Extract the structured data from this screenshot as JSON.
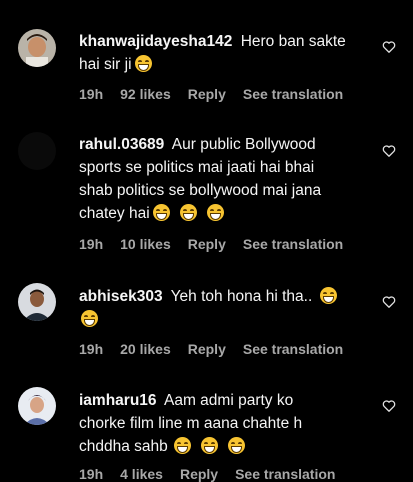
{
  "comments": [
    {
      "username": "khanwajidayesha142",
      "text_line1": "Hero ban sakte",
      "text_line2": "hai sir ji",
      "time": "19h",
      "likes": "92 likes",
      "reply": "Reply",
      "translation": "See translation"
    },
    {
      "username": "rahul.03689",
      "text_line1": "Aur public Bollywood",
      "text_line2": "sports se politics mai jaati hai bhai",
      "text_line3": "shab politics se bollywood mai jana",
      "text_line4": "chatey hai",
      "time": "19h",
      "likes": "10 likes",
      "reply": "Reply",
      "translation": "See translation"
    },
    {
      "username": "abhisek303",
      "text_line1": "Yeh toh hona hi tha..",
      "time": "19h",
      "likes": "20 likes",
      "reply": "Reply",
      "translation": "See translation"
    },
    {
      "username": "iamharu16",
      "text_line1": "Aam admi party ko",
      "text_line2": "chorke film line m aana chahte h",
      "text_line3": "chddha sahb",
      "time": "19h",
      "likes": "4 likes",
      "reply": "Reply",
      "translation": "See translation"
    }
  ],
  "icons": {
    "like": "heart-outline-icon",
    "emoji": "grinning-face-emoji"
  }
}
